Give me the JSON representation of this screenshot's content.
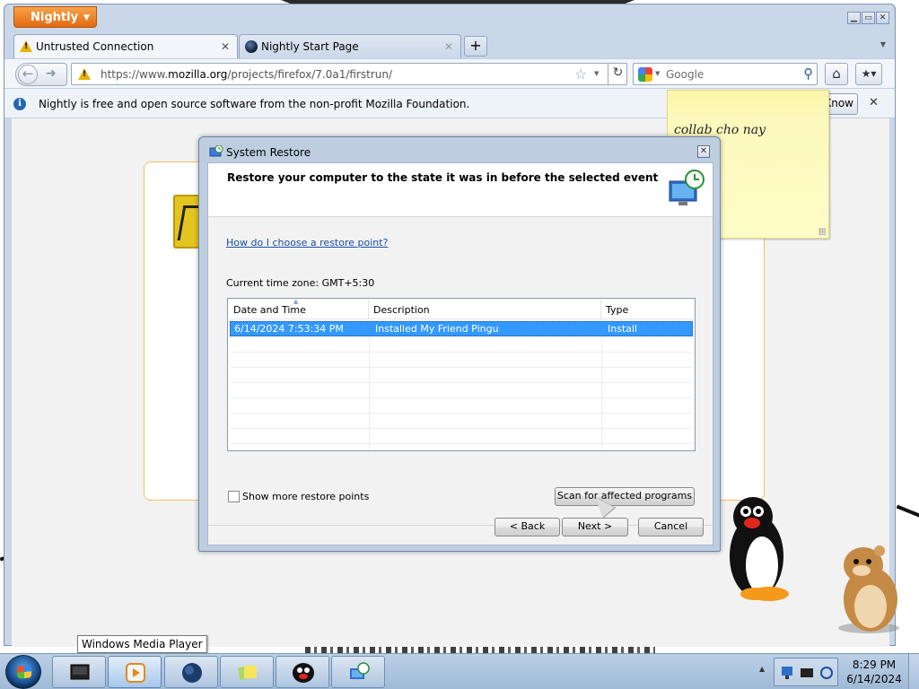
{
  "browser": {
    "app_menu_label": "Nightly",
    "tabs": [
      {
        "title": "Untrusted Connection",
        "active": true
      },
      {
        "title": "Nightly Start Page",
        "active": false
      }
    ],
    "new_tab_label": "+",
    "url": {
      "prefix": "https://www.",
      "domain": "mozilla.org",
      "path": "/projects/firefox/7.0a1/firstrun/"
    },
    "search": {
      "engine_icon": "google-icon",
      "placeholder": "Google"
    },
    "notification": {
      "text": "Nightly is free and open source software from the non-profit Mozilla Foundation.",
      "button_label": "Know your rights..."
    }
  },
  "sticky_note": {
    "text": "collab cho nay"
  },
  "dialog": {
    "title": "System Restore",
    "header": "Restore your computer to the state it was in before the selected event",
    "help_link": "How do I choose a restore point?",
    "timezone": "Current time zone: GMT+5:30",
    "table": {
      "columns": [
        "Date and Time",
        "Description",
        "Type"
      ],
      "rows": [
        {
          "date_time": "6/14/2024 7:53:34 PM",
          "description": "Installed My Friend Pingu",
          "type": "Install",
          "selected": true
        }
      ]
    },
    "show_more_label": "Show more restore points",
    "show_more_checked": false,
    "scan_button": "Scan for affected programs",
    "back_button": "< Back",
    "next_button": "Next >",
    "cancel_button": "Cancel"
  },
  "taskbar": {
    "tooltip": "Windows Media Player",
    "pinned": [
      "computer-icon",
      "media-player-icon",
      "globe-icon",
      "sticky-notes-icon",
      "pingu-icon",
      "system-restore-icon"
    ],
    "clock_time": "8:29 PM",
    "clock_date": "6/14/2024"
  },
  "colors": {
    "accent_orange": "#e06a12",
    "selection_blue": "#3399ff",
    "link_blue": "#1a4fa3",
    "sticky_yellow": "#fdf9bd"
  }
}
